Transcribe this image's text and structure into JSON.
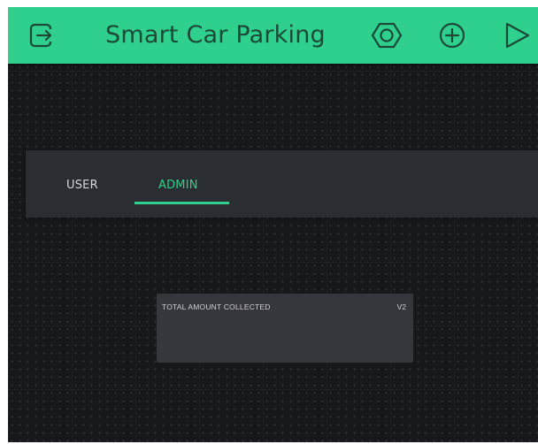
{
  "topbar": {
    "title": "Smart Car Parking",
    "icons": {
      "exit": "exit-icon",
      "settings": "hexagon-settings-icon",
      "add": "plus-circle-icon",
      "play": "play-icon"
    }
  },
  "tabs": [
    {
      "label": "USER",
      "selected": false
    },
    {
      "label": "ADMIN",
      "selected": true
    }
  ],
  "widget": {
    "label": "TOTAL AMOUNT COLLECTED",
    "pin": "V2",
    "value": ""
  },
  "colors": {
    "accent": "#2fcf8d",
    "topbar_text": "#1b4a37",
    "background": "#16181b",
    "tabbar": "#2a2d31",
    "widget": "#34373c"
  }
}
